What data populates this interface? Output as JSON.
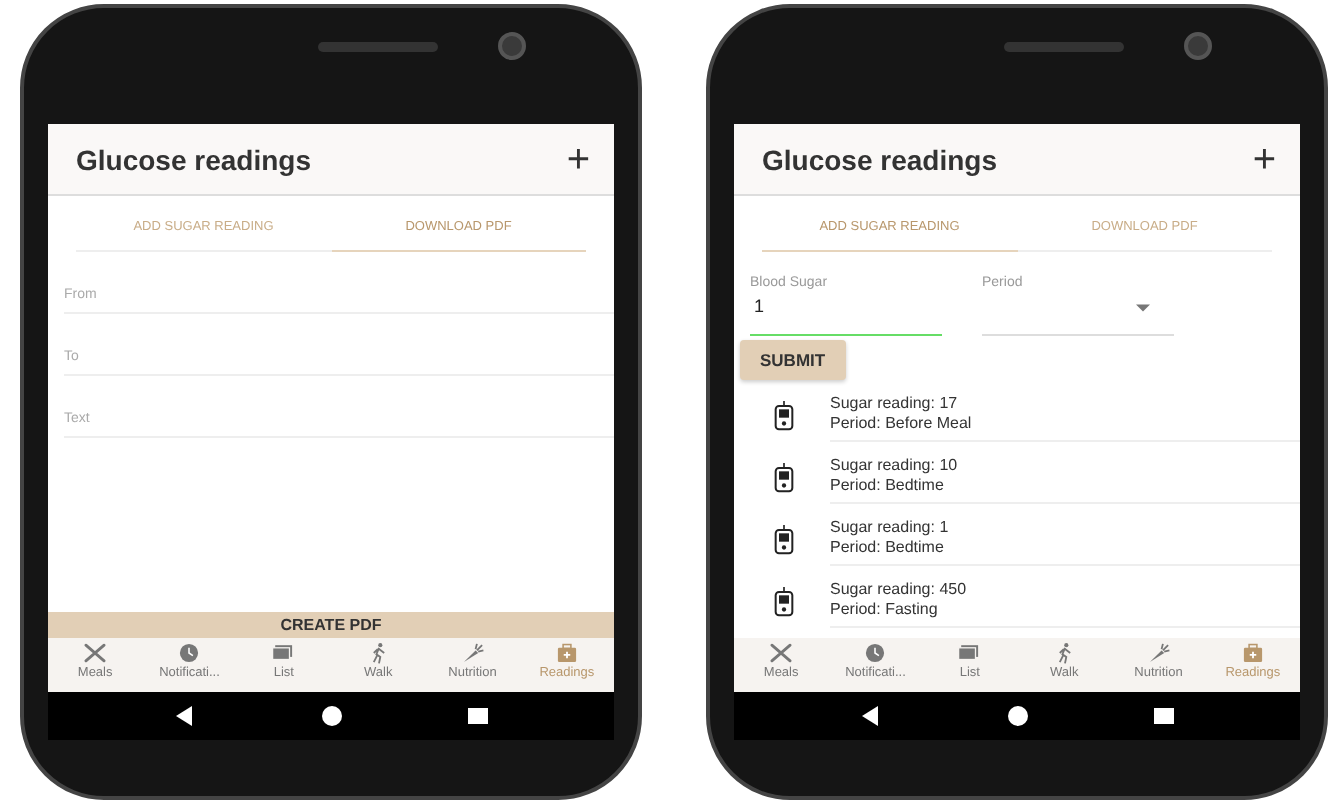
{
  "phones": [
    {
      "kind": "pdf",
      "title": "Glucose readings",
      "add_symbol": "+",
      "tabs": [
        {
          "label": "ADD SUGAR READING",
          "selected": false
        },
        {
          "label": "DOWNLOAD PDF",
          "selected": true
        }
      ],
      "fields": [
        {
          "label": "From"
        },
        {
          "label": "To"
        },
        {
          "label": "Text"
        }
      ],
      "button": "CREATE PDF",
      "bottom_nav": [
        {
          "label": "Meals",
          "selected": false
        },
        {
          "label": "Notificati...",
          "selected": false
        },
        {
          "label": "List",
          "selected": false
        },
        {
          "label": "Walk",
          "selected": false
        },
        {
          "label": "Nutrition",
          "selected": false
        },
        {
          "label": "Readings",
          "selected": true
        }
      ]
    },
    {
      "kind": "add",
      "title": "Glucose readings",
      "add_symbol": "+",
      "tabs": [
        {
          "label": "ADD SUGAR READING",
          "selected": true
        },
        {
          "label": "DOWNLOAD PDF",
          "selected": false
        }
      ],
      "inputs": [
        {
          "kind": "text",
          "label": "Blood Sugar",
          "value": "1",
          "focused": true
        },
        {
          "kind": "select",
          "label": "Period",
          "focused": false
        }
      ],
      "button": "SUBMIT",
      "readings": [
        {
          "reading": "Sugar reading: 17",
          "period": "Period: Before Meal"
        },
        {
          "reading": "Sugar reading: 10",
          "period": "Period: Bedtime"
        },
        {
          "reading": "Sugar reading: 1",
          "period": "Period: Bedtime"
        },
        {
          "reading": "Sugar reading: 450",
          "period": "Period: Fasting"
        }
      ],
      "bottom_nav": [
        {
          "label": "Meals",
          "selected": false
        },
        {
          "label": "Notificati...",
          "selected": false
        },
        {
          "label": "List",
          "selected": false
        },
        {
          "label": "Walk",
          "selected": false
        },
        {
          "label": "Nutrition",
          "selected": false
        },
        {
          "label": "Readings",
          "selected": true
        }
      ]
    }
  ]
}
